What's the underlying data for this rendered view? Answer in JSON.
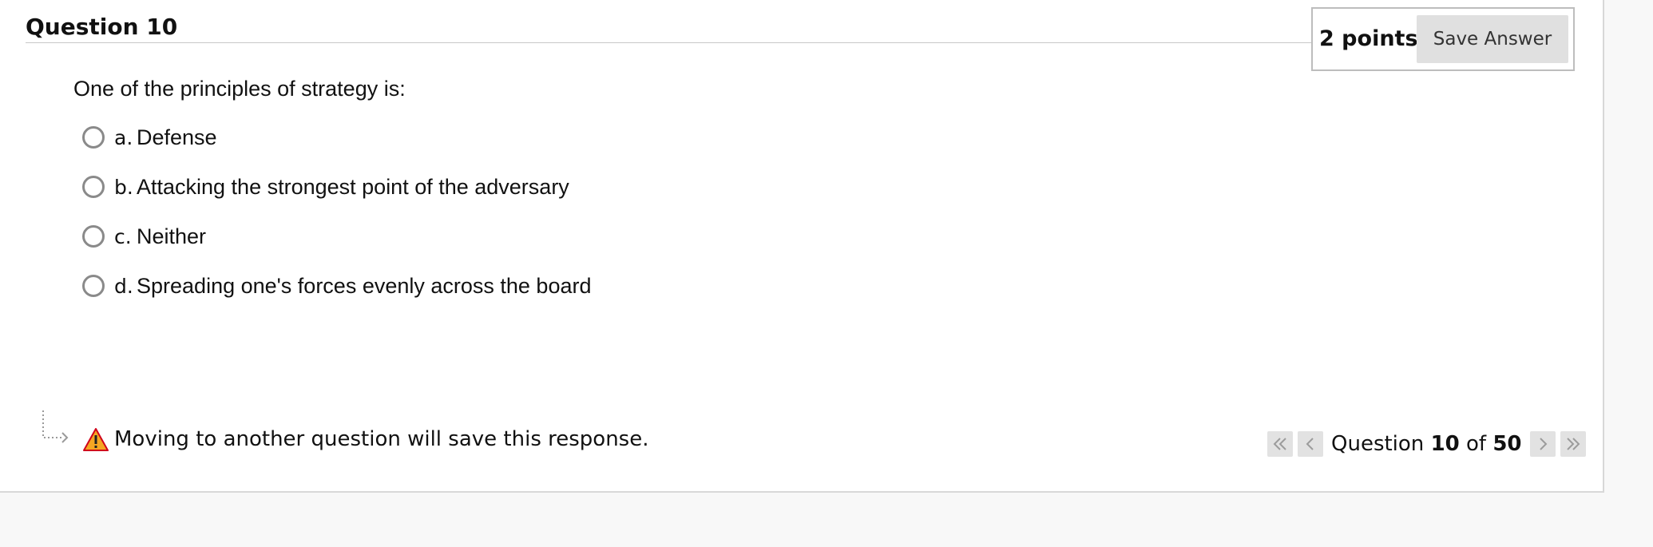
{
  "question": {
    "title": "Question 10",
    "points": "2 points",
    "save_label": "Save Answer",
    "prompt": "One of the principles of strategy is:",
    "options": [
      {
        "letter": "a.",
        "text": "Defense"
      },
      {
        "letter": "b.",
        "text": "Attacking the strongest point of the adversary"
      },
      {
        "letter": "c.",
        "text": "Neither"
      },
      {
        "letter": "d.",
        "text": "Spreading one's forces evenly across the board"
      }
    ]
  },
  "footer": {
    "warning": "Moving to another question will save this response.",
    "pager": {
      "prefix": "Question",
      "current": "10",
      "of": "of",
      "total": "50"
    }
  },
  "icons": {
    "warning": "warning-triangle-icon",
    "first": "double-chevron-left-icon",
    "prev": "chevron-left-icon",
    "next": "chevron-right-icon",
    "last": "double-chevron-right-icon"
  },
  "colors": {
    "page_bg": "#f8f8f8",
    "panel_bg": "#ffffff",
    "button_bg": "#e0e0e0",
    "warning_fill": "#f5a623",
    "warning_stroke": "#d0021b"
  }
}
